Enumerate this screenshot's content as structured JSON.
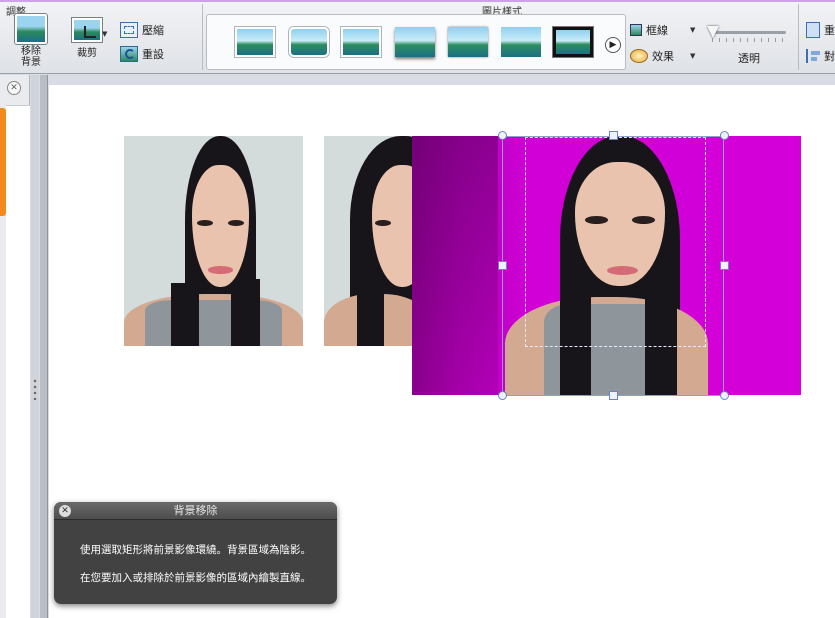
{
  "ribbon": {
    "adjust_group_label": "調整",
    "picture_styles_group_label": "圖片樣式",
    "remove_background_label": "移除\n背景",
    "crop_label": "裁剪",
    "compress_label": "壓縮",
    "reset_label": "重設",
    "border_label": "框線",
    "effects_label": "效果",
    "transparency_label": "透明",
    "transparency_value": 0,
    "right_cut_label_1": "重",
    "right_cut_label_2": "對",
    "accent_color": "#c9a3e6"
  },
  "left_pane": {
    "close_icon": "close-icon",
    "tab_color": "#f28a1e"
  },
  "slide": {
    "photo_bg_plain": "#d4dbdb",
    "photo_bg_removed": "#d400d9"
  },
  "dialog": {
    "title": "背景移除",
    "line1": "使用選取矩形將前景影像環繞。背景區域為陰影。",
    "line2": "在您要加入或排除於前景影像的區域內繪製直線。"
  }
}
